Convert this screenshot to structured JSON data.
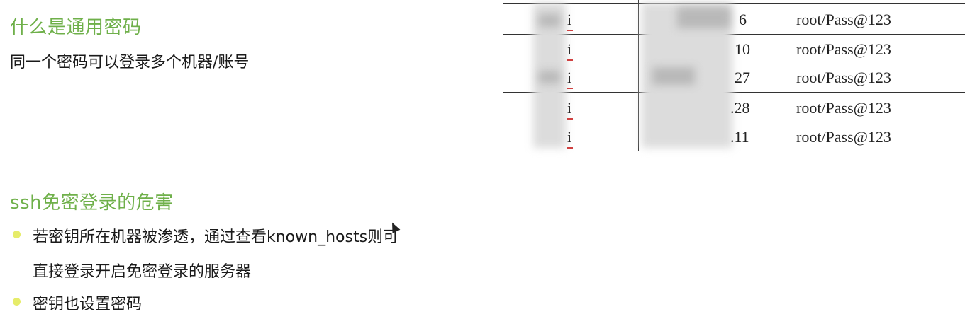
{
  "section1": {
    "title": "什么是通用密码",
    "desc": "同一个密码可以登录多个机器/账号"
  },
  "table": {
    "rows": [
      {
        "ip_suffix": "6",
        "cred": "root/Pass@123",
        "col1_suffix": "i"
      },
      {
        "ip_suffix": "10",
        "cred": "root/Pass@123",
        "col1_suffix": "i"
      },
      {
        "ip_suffix": "27",
        "cred": "root/Pass@123",
        "col1_suffix": "i"
      },
      {
        "ip_suffix": ".28",
        "cred": "root/Pass@123",
        "col1_suffix": "i"
      },
      {
        "ip_suffix": ".11",
        "cred": "root/Pass@123",
        "col1_suffix": "i"
      }
    ]
  },
  "section2": {
    "title": "ssh免密登录的危害",
    "bullets": [
      {
        "line1": "若密钥所在机器被渗透，通过查看known_hosts则可",
        "line2": "直接登录开启免密登录的服务器"
      },
      {
        "line1": "密钥也设置密码"
      }
    ]
  },
  "colors": {
    "heading": "#6fb04a",
    "bullet": "#e6ec6a"
  }
}
